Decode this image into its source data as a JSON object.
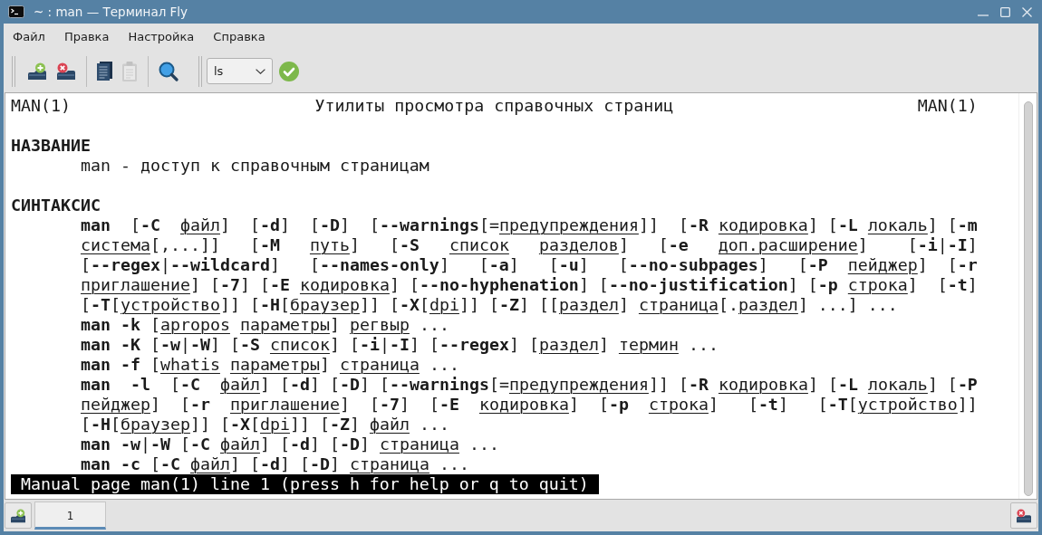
{
  "window": {
    "title": "~ : man — Терминал Fly"
  },
  "menu": [
    "Файл",
    "Правка",
    "Настройка",
    "Справка"
  ],
  "toolbar": {
    "groups": [
      [
        {
          "kind": "add",
          "disabled": false
        },
        {
          "kind": "remove",
          "disabled": false
        }
      ],
      [
        {
          "kind": "copy",
          "disabled": false
        },
        {
          "kind": "paste",
          "disabled": true
        }
      ],
      [
        {
          "kind": "search",
          "disabled": false
        }
      ]
    ],
    "command": {
      "value": "ls"
    }
  },
  "terminal": {
    "header": {
      "left": "MAN(1)",
      "title": "Утилиты просмотра справочных страниц",
      "right": "MAN(1)"
    },
    "sections": [
      {
        "heading": "НАЗВАНИЕ",
        "lines": [
          "man - доступ к справочным страницам"
        ]
      },
      {
        "heading": "СИНТАКСИС",
        "lines": [
          "**man**  [**-C**  *файл*]  [**-d**]  [**-D**]  [**--warnings**[=*предупреждения*]]  [**-R** *кодировка*] [**-L** *локаль*] [**-m**",
          "*система*[,...]]   [**-M**   *путь*]   [**-S**   *список*   *разделов*]   [**-e**   *доп.расширение*]    [**-i**|**-I**]",
          "[**--regex**|**--wildcard**]   [**--names-only**]   [**-a**]   [**-u**]   [**--no-subpages**]   [**-P**  *пейджер*]  [**-r**",
          "*приглашение*] [**-7**] [**-E** *кодировка*] [**--no-hyphenation**] [**--no-justification**] [**-p** *строка*]  [**-t**]",
          "[**-T**[*устройство*]] [**-H**[*браузер*]] [**-X**[*dpi*]] [**-Z**] [[*раздел*] *страница*[.*раздел*] ...] ...",
          "**man -k** [*apropos* *параметры*] *регвыр* ...",
          "**man -K** [**-w**|**-W**] [**-S** *список*] [**-i**|**-I**] [**--regex**] [*раздел*] *термин* ...",
          "**man -f** [*whatis* *параметры*] *страница* ...",
          "**man**  **-l**  [**-C**  *файл*] [**-d**] [**-D**] [**--warnings**[=*предупреждения*]] [**-R** *кодировка*] [**-L** *локаль*] [**-P**",
          "*пейджер*]  [**-r**  *приглашение*]  [**-7**]  [**-E**  *кодировка*]  [**-p**  *строка*]   [**-t**]   [**-T**[*устройство*]]",
          "[**-H**[*браузер*]] [**-X**[*dpi*]] [**-Z**] *файл* ...",
          "**man** **-w**|**-W** [**-C** *файл*] [**-d**] [**-D**] *страница* ...",
          "**man -c** [**-C** *файл*] [**-d**] [**-D**] *страница* ..."
        ]
      }
    ],
    "status": "Manual page man(1) line 1 (press h for help or q to quit)"
  },
  "tabs": [
    {
      "label": "1",
      "selected": true
    }
  ]
}
